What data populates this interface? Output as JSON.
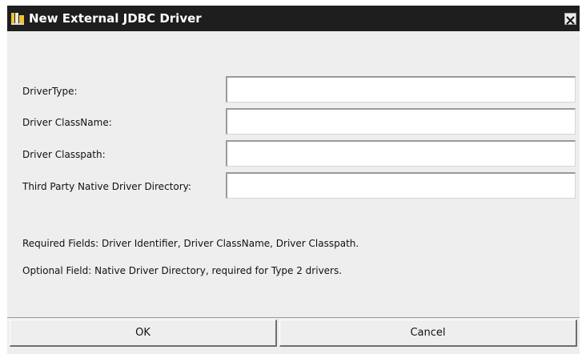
{
  "window": {
    "title": "New External JDBC Driver",
    "app_icon": "jdbc-driver-icon",
    "close_icon": "close-icon"
  },
  "form": {
    "fields": [
      {
        "label": "DriverType:",
        "value": ""
      },
      {
        "label": "Driver ClassName:",
        "value": ""
      },
      {
        "label": "Driver Classpath:",
        "value": ""
      },
      {
        "label": "Third Party Native Driver Directory:",
        "value": ""
      }
    ]
  },
  "info": {
    "required": "Required Fields: Driver Identifier, Driver ClassName, Driver Classpath.",
    "optional": "Optional Field: Native Driver Directory, required for Type 2 drivers."
  },
  "buttons": {
    "ok_label": "OK",
    "cancel_label": "Cancel"
  },
  "colors": {
    "titlebar": "#1e1e1e",
    "title_text": "#ffffff",
    "dialog_bg": "#eeeeee",
    "input_bg": "#ffffff"
  }
}
